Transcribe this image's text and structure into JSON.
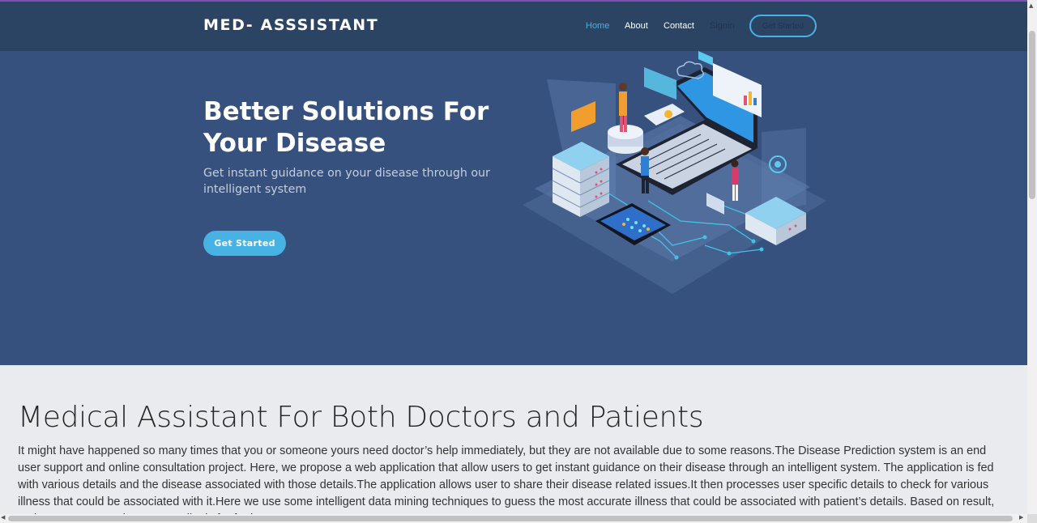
{
  "nav": {
    "brand": "MED- ASSSISTANT",
    "links": [
      "Home",
      "About",
      "Contact",
      "Signin"
    ],
    "cta": "Get Started"
  },
  "hero": {
    "title": "Better Solutions For Your Disease",
    "subtitle": "Get instant guidance on your disease through our intelligent system",
    "button": "Get Started",
    "illustration": "isometric-laptop-servers-doctors-illustration"
  },
  "section": {
    "title": "Medical Assistant For Both Doctors and Patients",
    "paragraph": "It might have happened so many times that you or someone yours need doctor’s help immediately, but they are not available due to some reasons.The Disease Prediction system is an end user support and online consultation project. Here, we propose a web application that allow users to get instant guidance on their disease through an intelligent system. The application is fed with various details and the disease associated with those details.The application allows user to share their disease related issues.It then processes user specific details to check for various illness that could be associated with it.Here we use some intelligent data mining techniques to guess the most accurate illness that could be associated with patient’s details. Based on result, patient can contact doctor accordingly for further treatment."
  },
  "colors": {
    "accent": "#47b2e4",
    "navbar": "#2c4464",
    "hero_bg": "#37517e",
    "section_bg": "#e9ebee"
  }
}
